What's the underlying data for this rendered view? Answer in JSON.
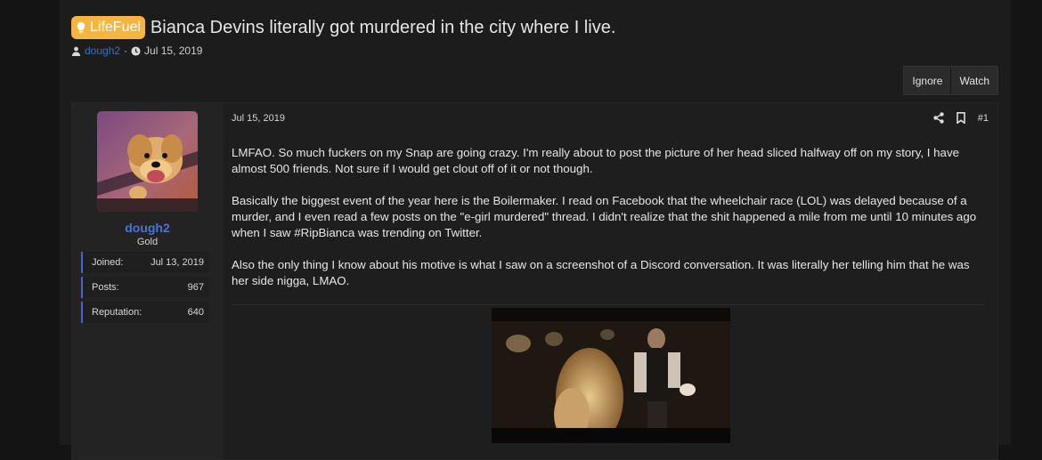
{
  "thread": {
    "prefix": "LifeFuel",
    "title": "Bianca Devins literally got murdered in the city where I live.",
    "author": "dough2",
    "date": "Jul 15, 2019"
  },
  "buttons": {
    "ignore": "Ignore",
    "watch": "Watch"
  },
  "post": {
    "date": "Jul 15, 2019",
    "number": "#1",
    "user": {
      "name": "dough2",
      "title": "Gold",
      "stats": [
        {
          "label": "Joined:",
          "value": "Jul 13, 2019"
        },
        {
          "label": "Posts:",
          "value": "967"
        },
        {
          "label": "Reputation:",
          "value": "640"
        }
      ]
    },
    "paragraphs": [
      "LMFAO. So much fuckers on my Snap are going crazy. I'm really about to post the picture of her head sliced halfway off on my story, I have almost 500 friends. Not sure if I would get clout off of it or not though.",
      "Basically the biggest event of the year here is the Boilermaker. I read on Facebook that the wheelchair race (LOL) was delayed because of a murder, and I even read a few posts on the \"e-girl murdered\" thread. I didn't realize that the shit happened a mile from me until 10 minutes ago when I saw #RipBianca was trending on Twitter.",
      "Also the only thing I know about his motive is what I saw on a screenshot of a Discord conversation. It was literally her telling him that he was her side nigga, LMAO."
    ]
  },
  "colors": {
    "accent": "#4c74d4",
    "prefix_bg": "#f6b540",
    "page_bg": "#1c1c1c"
  },
  "icons": [
    "user-icon",
    "clock-icon",
    "share-icon",
    "bookmark-icon",
    "lightbulb-icon"
  ]
}
